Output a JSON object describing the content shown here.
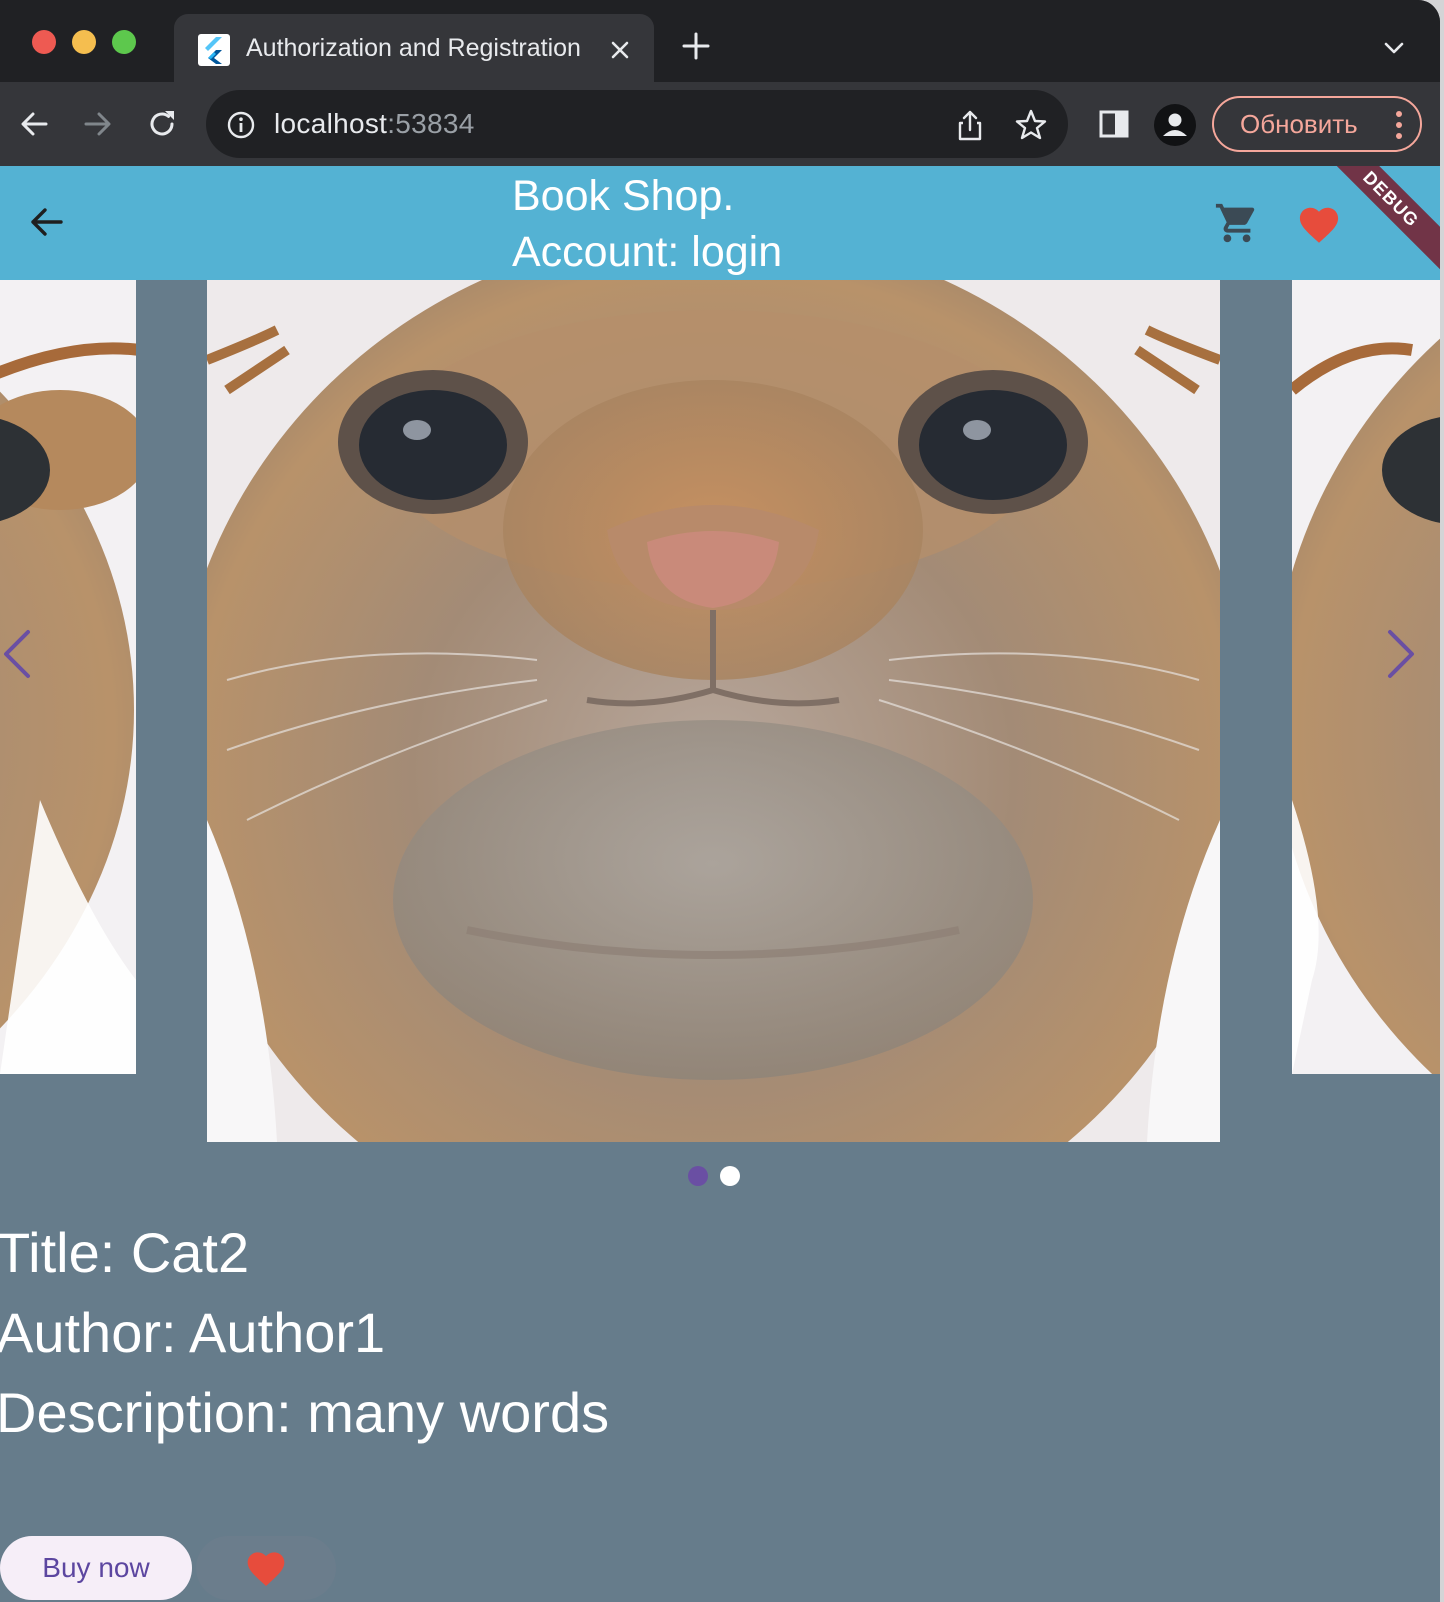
{
  "browser": {
    "tab": {
      "title": "Authorization and Registration"
    },
    "omnibox": {
      "host": "localhost",
      "port": ":53834"
    },
    "update_button": {
      "label": "Обновить"
    }
  },
  "appbar": {
    "title_line1": "Book Shop.",
    "title_line2": "Account: login",
    "debug_banner": "DEBUG",
    "colors": {
      "bar": "#54b2d3",
      "heart": "#e74c3c"
    }
  },
  "carousel": {
    "page_count": 2,
    "active_index": 0,
    "images": [
      "cat-photo",
      "cat-photo",
      "cat-photo"
    ]
  },
  "book": {
    "title": "Title: Cat2",
    "author": "Author: Author1",
    "description": "Description: many words"
  },
  "actions": {
    "buy_label": "Buy now"
  },
  "colors": {
    "background": "#667c8b",
    "accent": "#6a4fa3"
  }
}
